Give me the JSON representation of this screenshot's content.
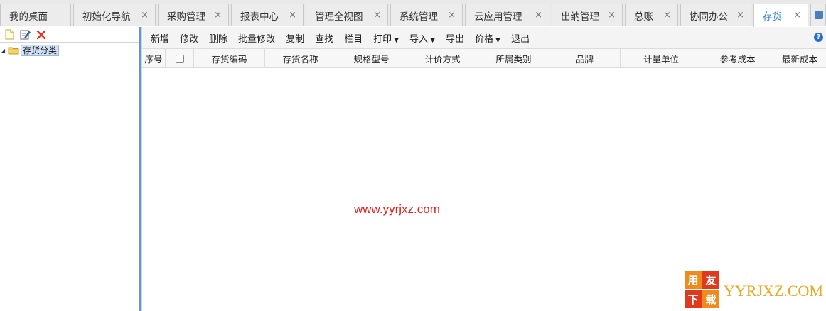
{
  "tabs": [
    {
      "label": "我的桌面",
      "closable": false,
      "active": false
    },
    {
      "label": "初始化导航",
      "closable": true,
      "active": false
    },
    {
      "label": "采购管理",
      "closable": true,
      "active": false
    },
    {
      "label": "报表中心",
      "closable": true,
      "active": false
    },
    {
      "label": "管理全视图",
      "closable": true,
      "active": false
    },
    {
      "label": "系统管理",
      "closable": true,
      "active": false
    },
    {
      "label": "云应用管理",
      "closable": true,
      "active": false
    },
    {
      "label": "出纳管理",
      "closable": true,
      "active": false
    },
    {
      "label": "总账",
      "closable": true,
      "active": false
    },
    {
      "label": "协同办公",
      "closable": true,
      "active": false
    },
    {
      "label": "存货",
      "closable": true,
      "active": true
    }
  ],
  "tab_close_glyph": "×",
  "left_panel": {
    "toolbar_icons": [
      "new-file-icon",
      "edit-icon",
      "delete-icon"
    ],
    "tree": [
      {
        "label": "存货分类",
        "expanded": true,
        "icon": "folder-icon"
      }
    ]
  },
  "toolbar": {
    "buttons": [
      {
        "label": "新增",
        "dropdown": false
      },
      {
        "label": "修改",
        "dropdown": false
      },
      {
        "label": "删除",
        "dropdown": false
      },
      {
        "label": "批量修改",
        "dropdown": false
      },
      {
        "label": "复制",
        "dropdown": false
      },
      {
        "label": "查找",
        "dropdown": false
      },
      {
        "label": "栏目",
        "dropdown": false
      },
      {
        "label": "打印",
        "dropdown": true
      },
      {
        "label": "导入",
        "dropdown": true
      },
      {
        "label": "导出",
        "dropdown": false
      },
      {
        "label": "价格",
        "dropdown": true
      },
      {
        "label": "退出",
        "dropdown": false
      }
    ],
    "help_glyph": "?"
  },
  "grid": {
    "columns": [
      "序号",
      "",
      "存货编码",
      "存货名称",
      "规格型号",
      "计价方式",
      "所属类别",
      "品牌",
      "计量单位",
      "参考成本",
      "最新成本"
    ],
    "rows": []
  },
  "watermark": "www.yyrjxz.com",
  "logo": {
    "chars": [
      "用",
      "友",
      "下",
      "载"
    ],
    "text": "YYRJXZ.COM",
    "colors": {
      "orange": "#f08a1c",
      "red": "#e03a1e",
      "gold": "#e8a61c"
    }
  },
  "colors": {
    "accent": "#2a7fd0",
    "splitter": "#6a93c7",
    "watermark": "#e0201a"
  }
}
